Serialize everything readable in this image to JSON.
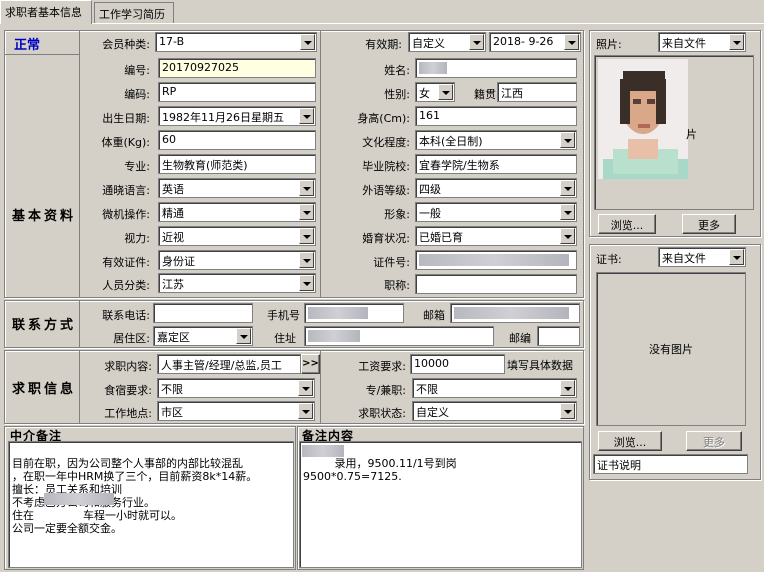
{
  "tabs": [
    {
      "label": "求职者基本信息"
    },
    {
      "label": "工作学习简历"
    }
  ],
  "status": "正常",
  "membership": {
    "label": "会员种类:",
    "value": "17-B"
  },
  "validity": {
    "label": "有效期:",
    "mode": "自定义",
    "date": "2018- 9-26"
  },
  "sections": {
    "basic": "基本资料",
    "contact": "联系方式",
    "job": "求职信息"
  },
  "basic": {
    "id_label": "编号:",
    "id_value": "20170927025",
    "name_label": "姓名:",
    "code_label": "编码:",
    "code_value": "RP",
    "gender_label": "性别:",
    "gender_value": "女",
    "native_label": "籍贯",
    "native_value": "江西",
    "birth_label": "出生日期:",
    "birth_value": "1982年11月26日星期五",
    "height_label": "身高(Cm):",
    "height_value": "161",
    "weight_label": "体重(Kg):",
    "weight_value": "60",
    "edu_label": "文化程度:",
    "edu_value": "本科(全日制)",
    "major_label": "专业:",
    "major_value": "生物教育(师范类)",
    "school_label": "毕业院校:",
    "school_value": "宜春学院/生物系",
    "lang_label": "通晓语言:",
    "lang_value": "英语",
    "foreign_label": "外语等级:",
    "foreign_value": "四级",
    "pc_label": "微机操作:",
    "pc_value": "精通",
    "image_label": "形象:",
    "image_value": "一般",
    "vision_label": "视力:",
    "vision_value": "近视",
    "marital_label": "婚育状况:",
    "marital_value": "已婚已育",
    "cert_label": "有效证件:",
    "cert_value": "身份证",
    "certno_label": "证件号:",
    "category_label": "人员分类:",
    "category_value": "江苏",
    "title_label": "职称:"
  },
  "contact": {
    "phone_label": "联系电话:",
    "mobile_label": "手机号",
    "email_label": "邮箱",
    "area_label": "居住区:",
    "area_value": "嘉定区",
    "address_label": "住址",
    "zip_label": "邮编"
  },
  "job": {
    "content_label": "求职内容:",
    "content_value": "人事主管/经理/总监,员工",
    "more_button": ">>",
    "salary_label": "工资要求:",
    "salary_value": "10000",
    "salary_hint": "填写具体数据",
    "board_label": "食宿要求:",
    "board_value": "不限",
    "type_label": "专/兼职:",
    "type_value": "不限",
    "location_label": "工作地点:",
    "location_value": "市区",
    "jobstatus_label": "求职状态:",
    "jobstatus_value": "自定义"
  },
  "photo": {
    "label": "照片:",
    "source": "来自文件",
    "browse": "浏览...",
    "more": "更多"
  },
  "certificate": {
    "label": "证书:",
    "source": "来自文件",
    "no_image": "没有图片",
    "browse": "浏览...",
    "more": "更多",
    "desc": "证书说明"
  },
  "memo_agency": {
    "title": "中介备注",
    "lines": [
      "目前在职，因为公司整个人事部的内部比较混乱",
      "，在职一年中HRM换了三个，目前薪资8k*14薪。",
      "擅长：员工关系和培训",
      "不考虑乙方公司和服务行业。",
      "住在              车程一小时就可以。",
      "公司一定要全额交金。"
    ]
  },
  "memo_notes": {
    "title": "备注内容",
    "lines": [
      "         录用，9500.11/1号到岗",
      "9500*0.75=7125."
    ]
  }
}
